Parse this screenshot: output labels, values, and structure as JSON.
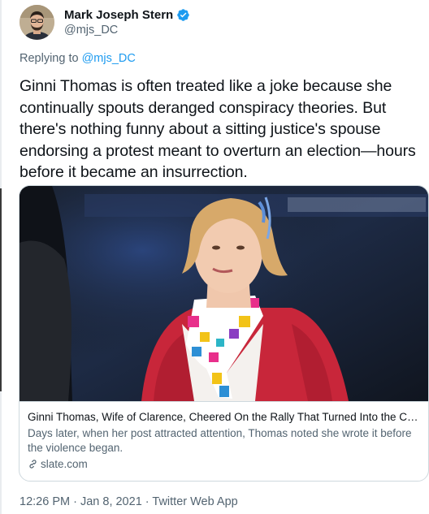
{
  "author": {
    "display_name": "Mark Joseph Stern",
    "handle": "@mjs_DC",
    "verified": true
  },
  "reply": {
    "prefix": "Replying to ",
    "handle": "@mjs_DC"
  },
  "tweet": {
    "text": "Ginni Thomas is often treated like a joke because she continually spouts deranged conspiracy theories. But there's nothing funny about a sitting justice's spouse endorsing a protest meant to overturn an election—hours before it became an insurrection."
  },
  "card": {
    "title": "Ginni Thomas, Wife of Clarence, Cheered On the Rally That Turned Into the Capi...",
    "description": "Days later, when her post attracted attention, Thomas noted she wrote it before the violence began.",
    "domain": "slate.com"
  },
  "meta": {
    "time": "12:26 PM",
    "separator": " · ",
    "date": "Jan 8, 2021",
    "app": "Twitter Web App"
  },
  "colors": {
    "link": "#1d9bf0",
    "secondary_text": "#536471",
    "primary_text": "#0f1419",
    "border": "#cfd9de",
    "cardigan": "#c8263a"
  },
  "icons": {
    "verified": "verified-badge-icon",
    "link": "link-icon"
  }
}
